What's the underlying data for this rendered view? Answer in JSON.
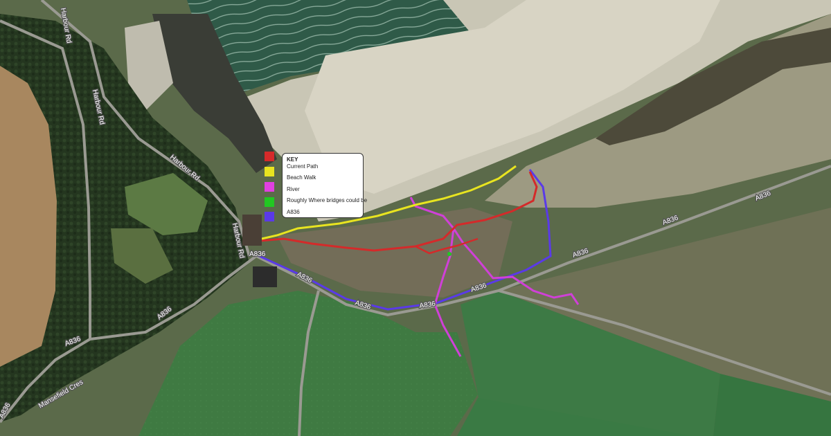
{
  "legend": {
    "title": "KEY",
    "items": [
      {
        "label": "Current Path",
        "color": "#d42a2a"
      },
      {
        "label": "Beach Walk",
        "color": "#e8e420"
      },
      {
        "label": "River",
        "color": "#e040e0"
      },
      {
        "label": "Roughly Where bridges could be",
        "color": "#22c822"
      },
      {
        "label": "A836",
        "color": "#5a3ae8"
      }
    ]
  },
  "road_labels": {
    "harbour_rd_top": "Harbour Rd",
    "harbour_rd_left": "Harbour Rd",
    "harbour_rd_mid": "Harbour Rd",
    "harbour_rd_lower": "Harbour Rd",
    "a836_a": "A836",
    "a836_b": "A836",
    "a836_c": "A836",
    "a836_d": "A836",
    "a836_e": "A836",
    "a836_f": "A836",
    "a836_g": "A836",
    "a836_h": "A836",
    "a836_i": "A836",
    "a836_j": "A836",
    "a836_k": "A836",
    "mansefield_cres": "Mansefield Cres"
  }
}
